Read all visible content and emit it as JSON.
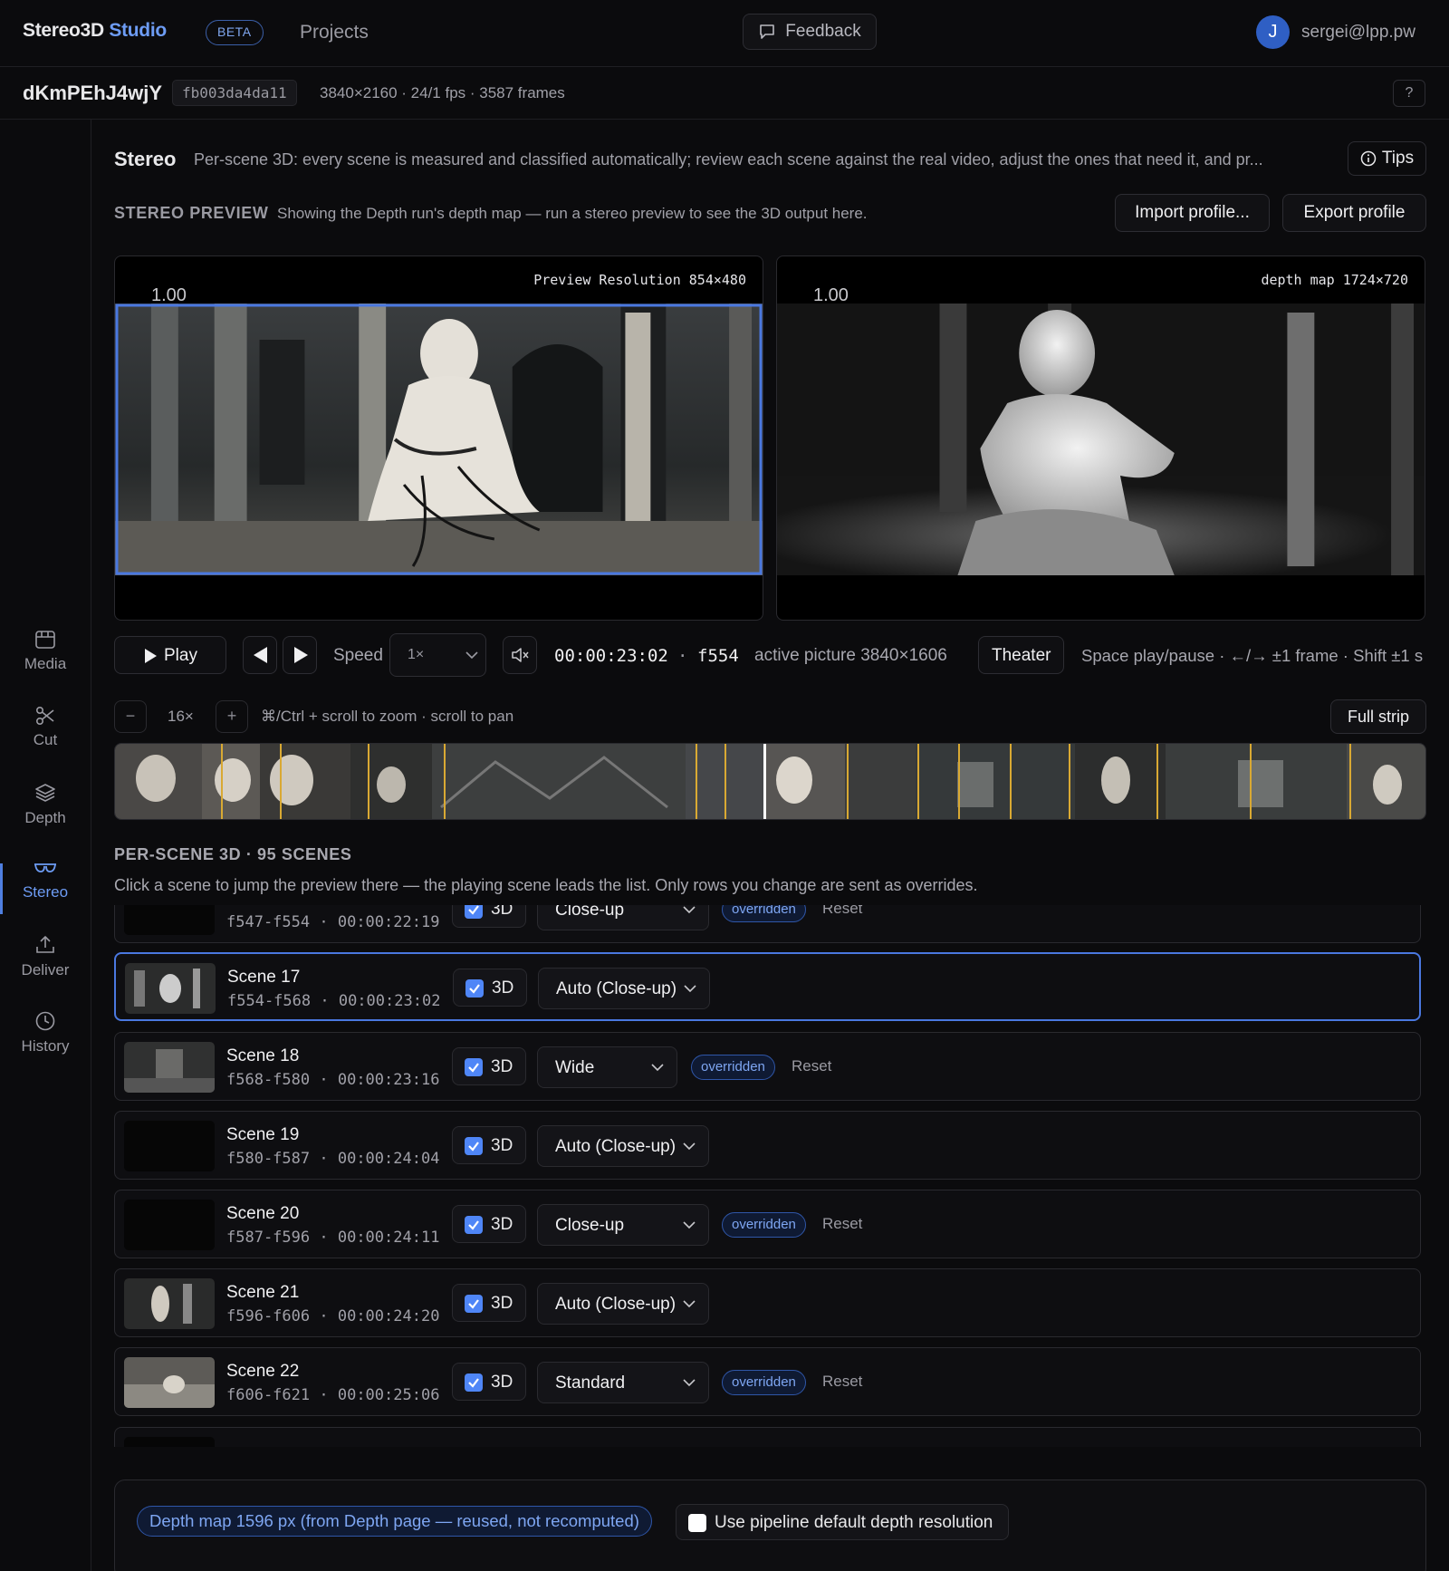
{
  "brand": {
    "name": "Stereo3D",
    "accent": "Studio",
    "badge": "BETA"
  },
  "nav": {
    "projects": "Projects",
    "feedback": "Feedback"
  },
  "user": {
    "initial": "J",
    "email": "sergei@lpp.pw"
  },
  "project": {
    "id": "dKmPEhJ4wjY",
    "hash": "fb003da4da11",
    "meta": "3840×2160 · 24/1 fps · 3587 frames",
    "help": "?"
  },
  "sidebar": {
    "items": [
      {
        "label": "Media",
        "icon": "film-icon"
      },
      {
        "label": "Cut",
        "icon": "scissors-icon"
      },
      {
        "label": "Depth",
        "icon": "layers-icon"
      },
      {
        "label": "Stereo",
        "icon": "glasses-icon"
      },
      {
        "label": "Deliver",
        "icon": "upload-icon"
      },
      {
        "label": "History",
        "icon": "clock-icon"
      }
    ],
    "active": "Stereo"
  },
  "header": {
    "title": "Stereo",
    "description": "Per-scene 3D: every scene is measured and classified automatically; review each scene against the real video, adjust the ones that need it, and pr...",
    "tips": "Tips"
  },
  "stereo_preview": {
    "title": "STEREO PREVIEW",
    "description": "Showing the Depth run's depth map — run a stereo preview to see the 3D output here.",
    "import_label": "Import profile...",
    "export_label": "Export profile",
    "left": {
      "label": "Preview Resolution 854×480",
      "value": "1.00"
    },
    "right": {
      "label": "depth map 1724×720",
      "value": "1.00"
    }
  },
  "transport": {
    "play": "Play",
    "speed_label": "Speed",
    "speed_value": "1×",
    "timecode": "00:00:23:02",
    "sep": "·",
    "frame": "f554",
    "active_picture": "active picture 3840×1606",
    "theater": "Theater",
    "shortcuts": "Space play/pause · ←/→ ±1 frame · Shift ±1 s"
  },
  "zoom": {
    "minus": "−",
    "level": "16×",
    "plus": "+",
    "hint": "⌘/Ctrl + scroll to zoom · scroll to pan",
    "full_strip": "Full strip"
  },
  "scenes": {
    "title": "PER-SCENE 3D · 95 SCENES",
    "description": "Click a scene to jump the preview there — the playing scene leads the list. Only rows you change are sent as overrides.",
    "check_label": "3D",
    "override_label": "overridden",
    "reset_label": "Reset",
    "rows": [
      {
        "name": "",
        "range": "f547-f554",
        "time": "00:00:22:19",
        "profile": "Close-up",
        "overridden": true
      },
      {
        "name": "Scene 17",
        "range": "f554-f568",
        "time": "00:00:23:02",
        "profile": "Auto (Close-up)",
        "overridden": false,
        "selected": true
      },
      {
        "name": "Scene 18",
        "range": "f568-f580",
        "time": "00:00:23:16",
        "profile": "Wide",
        "overridden": true
      },
      {
        "name": "Scene 19",
        "range": "f580-f587",
        "time": "00:00:24:04",
        "profile": "Auto (Close-up)",
        "overridden": false
      },
      {
        "name": "Scene 20",
        "range": "f587-f596",
        "time": "00:00:24:11",
        "profile": "Close-up",
        "overridden": true
      },
      {
        "name": "Scene 21",
        "range": "f596-f606",
        "time": "00:00:24:20",
        "profile": "Auto (Close-up)",
        "overridden": false
      },
      {
        "name": "Scene 22",
        "range": "f606-f621",
        "time": "00:00:25:06",
        "profile": "Standard",
        "overridden": true
      }
    ]
  },
  "bottom": {
    "depth_map_note": "Depth map 1596 px (from Depth page — reused, not recomputed)",
    "use_default_label": "Use pipeline default depth resolution"
  },
  "colors": {
    "accent": "#6d9cf4",
    "selection": "#4a78e0",
    "cut_marker": "#d9a933",
    "background": "#0b0b0d"
  }
}
